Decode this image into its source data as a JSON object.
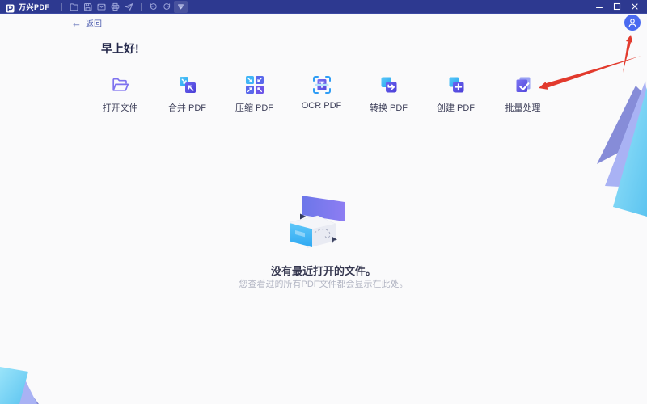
{
  "titlebar": {
    "app_name": "万兴PDF",
    "bg_color": "#2d3990",
    "toolbar_icons": [
      "open-folder",
      "save",
      "email",
      "print",
      "share",
      "undo",
      "redo",
      "hide-toolbar"
    ],
    "window_controls": [
      "minimize",
      "maximize",
      "close"
    ]
  },
  "nav": {
    "back_arrow": "←",
    "back_label": "返回"
  },
  "header": {
    "greeting": "早上好!"
  },
  "user": {
    "avatar_icon": "person",
    "avatar_color": "#4a6af0"
  },
  "actions": [
    {
      "id": "open-file",
      "label": "打开文件"
    },
    {
      "id": "merge-pdf",
      "label": "合并 PDF"
    },
    {
      "id": "compress-pdf",
      "label": "压缩 PDF"
    },
    {
      "id": "ocr-pdf",
      "label": "OCR PDF"
    },
    {
      "id": "convert-pdf",
      "label": "转换 PDF"
    },
    {
      "id": "create-pdf",
      "label": "创建 PDF"
    },
    {
      "id": "batch-process",
      "label": "批量处理"
    }
  ],
  "empty_state": {
    "title": "没有最近打开的文件。",
    "subtitle": "您查看过的所有PDF文件都会显示在此处。"
  },
  "annotations": {
    "arrow_color": "#e23a2d",
    "arrows_point_at": [
      "batch-process",
      "avatar"
    ]
  }
}
